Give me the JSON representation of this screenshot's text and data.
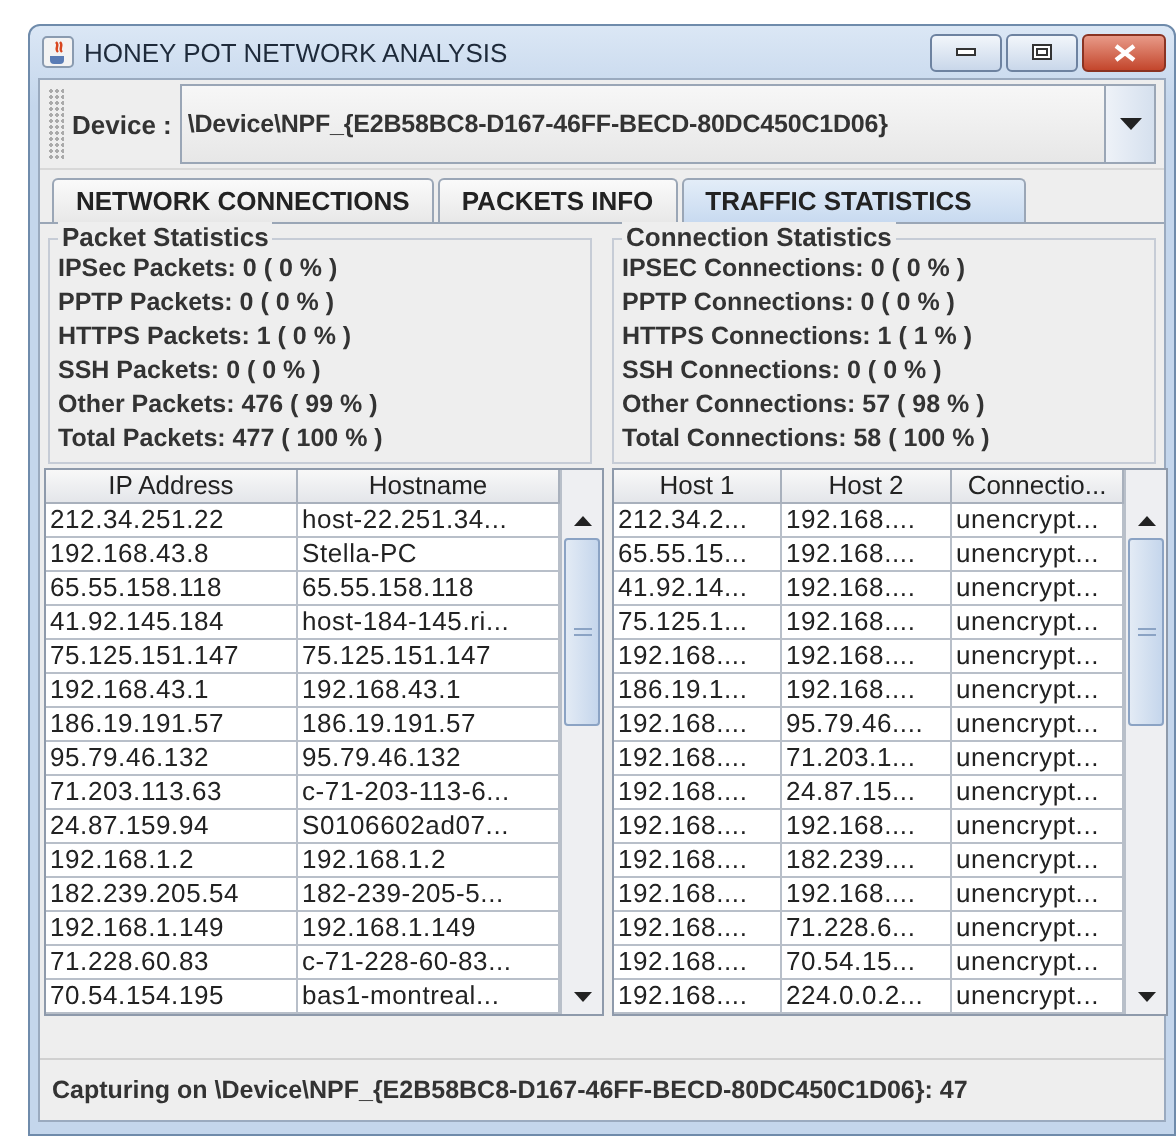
{
  "window": {
    "title": "HONEY POT NETWORK ANALYSIS"
  },
  "device": {
    "label": "Device :",
    "value": "\\Device\\NPF_{E2B58BC8-D167-46FF-BECD-80DC450C1D06}"
  },
  "tabs": [
    {
      "label": "NETWORK CONNECTIONS",
      "selected": false
    },
    {
      "label": "PACKETS INFO",
      "selected": false
    },
    {
      "label": "TRAFFIC STATISTICS",
      "selected": true
    }
  ],
  "packet_statistics": {
    "title": "Packet Statistics",
    "lines": [
      "IPSec Packets: 0 ( 0 % )",
      "PPTP Packets: 0 ( 0 % )",
      "HTTPS Packets: 1 ( 0 % )",
      "SSH Packets: 0 ( 0 % )",
      "Other Packets: 476 ( 99 % )",
      "Total Packets: 477 ( 100 % )"
    ]
  },
  "connection_statistics": {
    "title": "Connection Statistics",
    "lines": [
      "IPSEC Connections: 0 ( 0 % )",
      "PPTP Connections: 0 ( 0 % )",
      "HTTPS Connections: 1 ( 1 % )",
      "SSH Connections: 0 ( 0 % )",
      "Other Connections: 57 ( 98 % )",
      "Total Connections: 58 ( 100 % )"
    ]
  },
  "hosts_table": {
    "columns": [
      "IP Address",
      "Hostname"
    ],
    "rows": [
      [
        "212.34.251.22",
        "host-22.251.34..."
      ],
      [
        "192.168.43.8",
        "Stella-PC"
      ],
      [
        "65.55.158.118",
        "65.55.158.118"
      ],
      [
        "41.92.145.184",
        "host-184-145.ri..."
      ],
      [
        "75.125.151.147",
        "75.125.151.147"
      ],
      [
        "192.168.43.1",
        "192.168.43.1"
      ],
      [
        "186.19.191.57",
        "186.19.191.57"
      ],
      [
        "95.79.46.132",
        "95.79.46.132"
      ],
      [
        "71.203.113.63",
        "c-71-203-113-6..."
      ],
      [
        "24.87.159.94",
        "S0106602ad07..."
      ],
      [
        "192.168.1.2",
        "192.168.1.2"
      ],
      [
        "182.239.205.54",
        "182-239-205-5..."
      ],
      [
        "192.168.1.149",
        "192.168.1.149"
      ],
      [
        "71.228.60.83",
        "c-71-228-60-83..."
      ],
      [
        "70.54.154.195",
        "bas1-montreal..."
      ]
    ]
  },
  "connections_table": {
    "columns": [
      "Host 1",
      "Host 2",
      "Connectio..."
    ],
    "rows": [
      [
        "212.34.2...",
        "192.168....",
        "unencrypt..."
      ],
      [
        "65.55.15...",
        "192.168....",
        "unencrypt..."
      ],
      [
        "41.92.14...",
        "192.168....",
        "unencrypt..."
      ],
      [
        "75.125.1...",
        "192.168....",
        "unencrypt..."
      ],
      [
        "192.168....",
        "192.168....",
        "unencrypt..."
      ],
      [
        "186.19.1...",
        "192.168....",
        "unencrypt..."
      ],
      [
        "192.168....",
        "95.79.46....",
        "unencrypt..."
      ],
      [
        "192.168....",
        "71.203.1...",
        "unencrypt..."
      ],
      [
        "192.168....",
        "24.87.15...",
        "unencrypt..."
      ],
      [
        "192.168....",
        "192.168....",
        "unencrypt..."
      ],
      [
        "192.168....",
        "182.239....",
        "unencrypt..."
      ],
      [
        "192.168....",
        "192.168....",
        "unencrypt..."
      ],
      [
        "192.168....",
        "71.228.6...",
        "unencrypt..."
      ],
      [
        "192.168....",
        "70.54.15...",
        "unencrypt..."
      ],
      [
        "192.168....",
        "224.0.0.2...",
        "unencrypt..."
      ]
    ]
  },
  "status_bar": "Capturing on \\Device\\NPF_{E2B58BC8-D167-46FF-BECD-80DC450C1D06}: 47"
}
